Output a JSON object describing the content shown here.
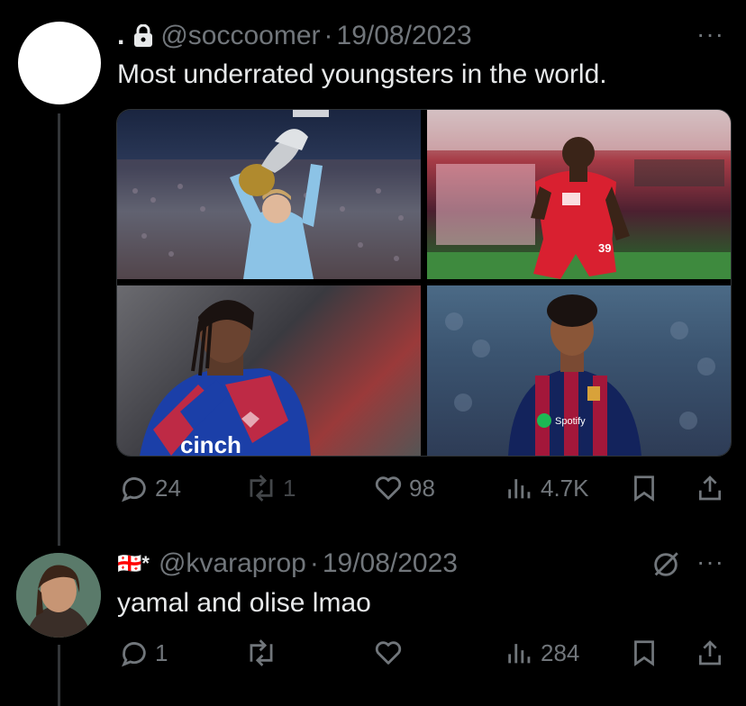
{
  "tweet": {
    "display_name": ".",
    "handle": "@soccoomer",
    "separator": "·",
    "date": "19/08/2023",
    "text": "Most underrated youngsters in the world.",
    "more": "···",
    "media": [
      {
        "description": "player-lifting-trophy"
      },
      {
        "description": "player-red-kit",
        "kit_number": "39"
      },
      {
        "description": "player-crystal-palace-kit",
        "sponsor": "cinch"
      },
      {
        "description": "player-barcelona-kit",
        "sponsor": "Spotify"
      }
    ],
    "stats": {
      "replies": "24",
      "reposts": "1",
      "likes": "98",
      "views": "4.7K"
    }
  },
  "reply": {
    "name_flag": "🇬🇪*",
    "handle": "@kvaraprop",
    "separator": "·",
    "date": "19/08/2023",
    "text": "yamal and olise lmao",
    "more": "···",
    "stats": {
      "replies": "1",
      "reposts": "",
      "likes": "",
      "views": "284"
    }
  },
  "colors": {
    "background": "#000000",
    "text": "#e7e9ea",
    "secondary": "#71767b",
    "divider": "#333639"
  }
}
